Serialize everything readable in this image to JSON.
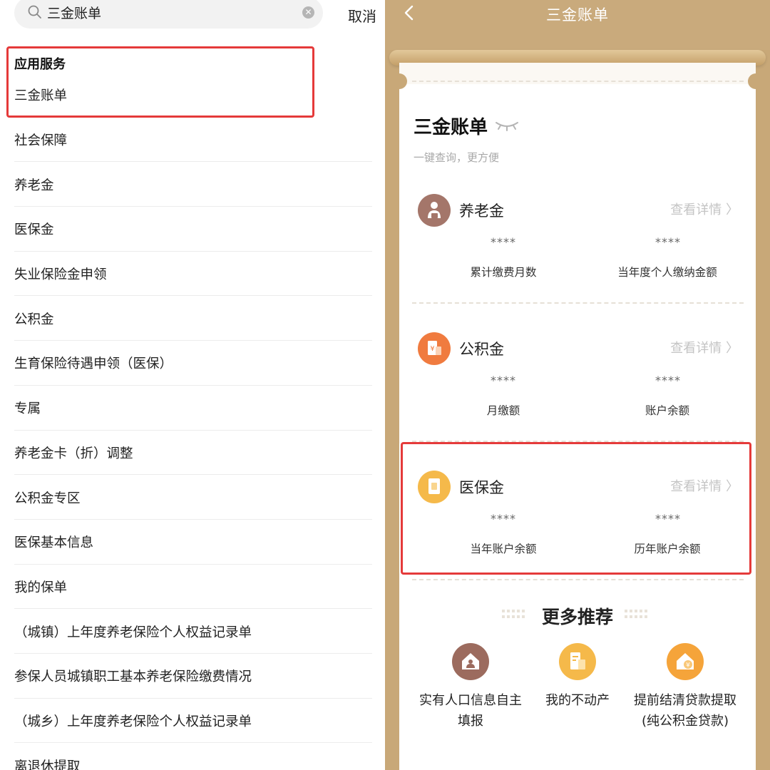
{
  "search": {
    "query": "三金账单",
    "cancel_label": "取消"
  },
  "results": {
    "section_header": "应用服务",
    "items": [
      "三金账单",
      "社会保障",
      "养老金",
      "医保金",
      "失业保险金申领",
      "公积金",
      "生育保险待遇申领（医保）",
      "专属",
      "养老金卡（折）调整",
      "公积金专区",
      "医保基本信息",
      "我的保单",
      "（城镇）上年度养老保险个人权益记录单",
      "参保人员城镇职工基本养老保险缴费情况",
      "（城乡）上年度养老保险个人权益记录单",
      "离退休提取"
    ]
  },
  "nav": {
    "title": "三金账单"
  },
  "card": {
    "title": "三金账单",
    "subtitle": "一键查询，更方便",
    "detail_label": "查看详情 〉",
    "masked_value": "****",
    "funds": [
      {
        "name": "养老金",
        "metric_a": "累计缴费月数",
        "metric_b": "当年度个人缴纳金额",
        "icon": "elder-person-icon",
        "color": "#a4766a"
      },
      {
        "name": "公积金",
        "metric_a": "月缴额",
        "metric_b": "账户余额",
        "icon": "housing-fund-icon",
        "color": "#f07b3f"
      },
      {
        "name": "医保金",
        "metric_a": "当年账户余额",
        "metric_b": "历年账户余额",
        "icon": "medical-card-icon",
        "color": "#f5b94a"
      }
    ]
  },
  "more": {
    "title": "更多推荐",
    "items": [
      {
        "line1": "实有人口信息自主",
        "line2": "填报",
        "icon": "house-person-icon",
        "color": "#9c6b5e"
      },
      {
        "line1": "我的不动产",
        "line2": "",
        "icon": "property-document-icon",
        "color": "#f5b94a"
      },
      {
        "line1": "提前结清贷款提取",
        "line2": "(纯公积金贷款)",
        "icon": "loan-house-icon",
        "color": "#f5a43a"
      }
    ]
  }
}
